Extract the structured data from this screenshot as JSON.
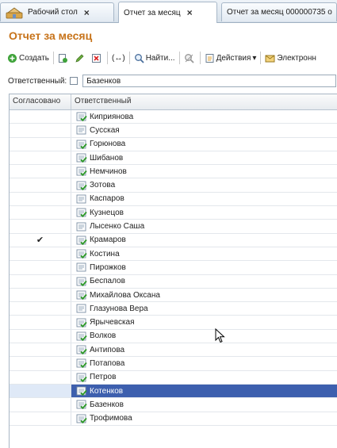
{
  "tabs": [
    {
      "label": "Рабочий стол",
      "close": "×"
    },
    {
      "label": "Отчет за месяц",
      "close": "×"
    },
    {
      "label": "Отчет за месяц 000000735 о"
    }
  ],
  "title": "Отчет за месяц",
  "toolbar": {
    "create": "Создать",
    "link_symbol": "(↔)",
    "find": "Найти...",
    "actions": "Действия",
    "actions_arrow": "▾",
    "electronic": "Электронн"
  },
  "filter": {
    "label": "Ответственный:",
    "value": "Базенков"
  },
  "columns": {
    "approved": "Согласовано",
    "responsible": "Ответственный"
  },
  "rows": [
    {
      "name": "Киприянова",
      "icon": "doc-posted-icon",
      "approved": ""
    },
    {
      "name": "Сусская",
      "icon": "doc-icon",
      "approved": ""
    },
    {
      "name": "Горюнова",
      "icon": "doc-posted-icon",
      "approved": ""
    },
    {
      "name": "Шибанов",
      "icon": "doc-posted-icon",
      "approved": ""
    },
    {
      "name": "Немчинов",
      "icon": "doc-posted-icon",
      "approved": ""
    },
    {
      "name": "Зотова",
      "icon": "doc-posted-icon",
      "approved": ""
    },
    {
      "name": "Каспаров",
      "icon": "doc-icon",
      "approved": ""
    },
    {
      "name": "Кузнецов",
      "icon": "doc-posted-icon",
      "approved": ""
    },
    {
      "name": "Лысенко Саша",
      "icon": "doc-icon",
      "approved": ""
    },
    {
      "name": "Крамаров",
      "icon": "doc-posted-icon",
      "approved": "✔"
    },
    {
      "name": "Костина",
      "icon": "doc-posted-icon",
      "approved": ""
    },
    {
      "name": "Пирожков",
      "icon": "doc-icon",
      "approved": ""
    },
    {
      "name": "Беспалов",
      "icon": "doc-posted-icon",
      "approved": ""
    },
    {
      "name": "Михайлова Оксана",
      "icon": "doc-posted-icon",
      "approved": ""
    },
    {
      "name": "Глазунова Вера",
      "icon": "doc-icon",
      "approved": ""
    },
    {
      "name": "Ярычевская",
      "icon": "doc-posted-icon",
      "approved": ""
    },
    {
      "name": "Волков",
      "icon": "doc-posted-icon",
      "approved": ""
    },
    {
      "name": "Антипова",
      "icon": "doc-posted-icon",
      "approved": ""
    },
    {
      "name": "Потапова",
      "icon": "doc-posted-icon",
      "approved": ""
    },
    {
      "name": "Петров",
      "icon": "doc-posted-icon",
      "approved": ""
    },
    {
      "name": "Котенков",
      "icon": "doc-posted-icon",
      "approved": "",
      "selected": true
    },
    {
      "name": "Базенков",
      "icon": "doc-posted-icon",
      "approved": ""
    },
    {
      "name": "Трофимова",
      "icon": "doc-posted-icon",
      "approved": ""
    }
  ],
  "colors": {
    "title": "#c7731a",
    "selection": "#3d5fae"
  }
}
